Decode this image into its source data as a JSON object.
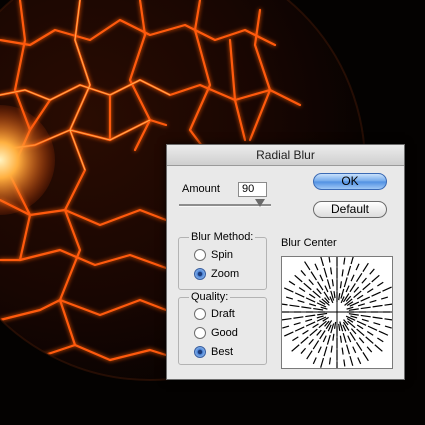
{
  "dialog": {
    "title": "Radial Blur",
    "amount": {
      "label": "Amount",
      "value": "90"
    },
    "buttons": {
      "ok": "OK",
      "default": "Default"
    },
    "blur_method": {
      "title": "Blur Method:",
      "options": [
        "Spin",
        "Zoom"
      ],
      "selected": "Zoom"
    },
    "quality": {
      "title": "Quality:",
      "options": [
        "Draft",
        "Good",
        "Best"
      ],
      "selected": "Best"
    },
    "blur_center": {
      "label": "Blur Center"
    }
  },
  "colors": {
    "accent_blue": "#5b97e6",
    "lava_glow": "#ff6a1a",
    "dialog_bg": "#e9e9e9"
  }
}
